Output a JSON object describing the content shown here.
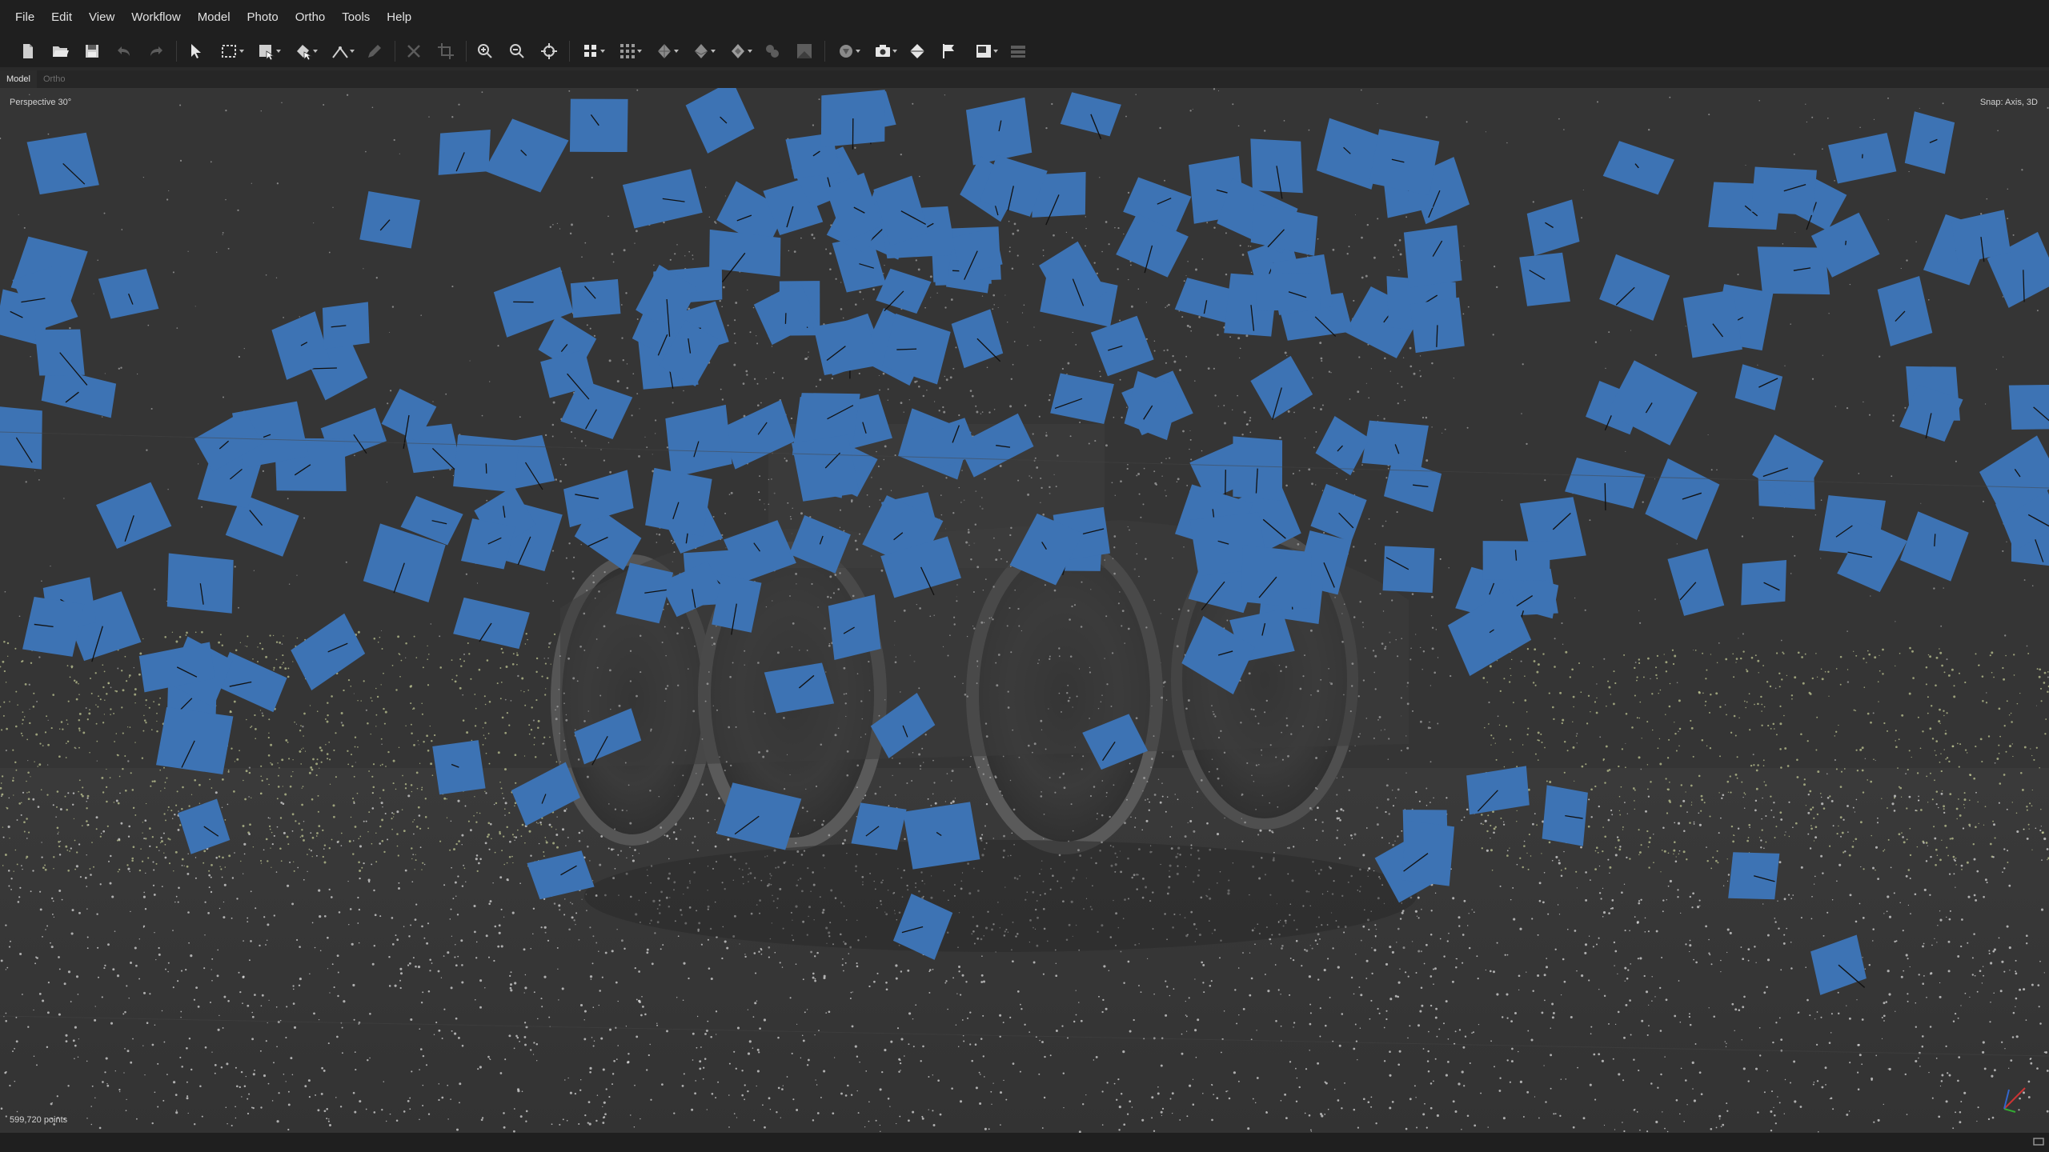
{
  "menu": [
    "File",
    "Edit",
    "View",
    "Workflow",
    "Model",
    "Photo",
    "Ortho",
    "Tools",
    "Help"
  ],
  "toolbar_icons": [
    "new-document-icon",
    "open-folder-icon",
    "save-icon",
    "undo-icon",
    "redo-icon",
    "pointer-icon",
    "rectangle-selection-icon",
    "selection-mode-icon",
    "shape-tools-icon",
    "ruler-icon",
    "pencil-icon",
    "delete-icon",
    "crop-icon",
    "zoom-in-icon",
    "zoom-out-icon",
    "reset-view-icon",
    "point-cloud-icon",
    "dense-cloud-icon",
    "mesh-icon",
    "tiled-model-icon",
    "texture-icon",
    "dem-icon",
    "orthomosaic-icon",
    "camera-icon",
    "show-cameras-icon",
    "markers-icon",
    "show-images-icon",
    "layers-icon"
  ],
  "tabs": [
    "Model",
    "Ortho"
  ],
  "viewport": {
    "view_mode": "Perspective 30°",
    "snap_status": "Snap: Axis, 3D",
    "point_count": "599,720 points"
  },
  "colors": {
    "camera_plane": "#3d73b4",
    "background": "#353535",
    "menubar": "#1f1f1f",
    "points_light": "#d8d8d8",
    "points_yellow": "#c8cf98"
  }
}
